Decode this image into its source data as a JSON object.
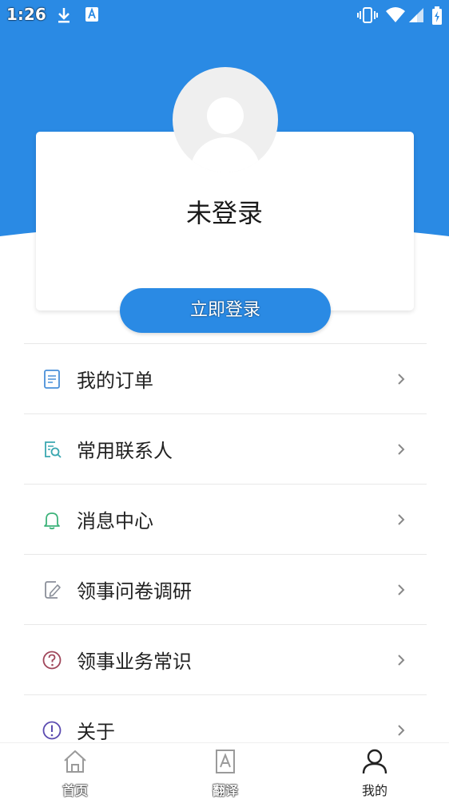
{
  "status_bar": {
    "time": "1:26"
  },
  "profile": {
    "status": "未登录",
    "login_button": "立即登录"
  },
  "menu": {
    "items": [
      {
        "label": "我的订单",
        "icon": "order-list-icon",
        "color": "#4a90d9"
      },
      {
        "label": "常用联系人",
        "icon": "contacts-search-icon",
        "color": "#3aa7b0"
      },
      {
        "label": "消息中心",
        "icon": "bell-icon",
        "color": "#3db37a"
      },
      {
        "label": "领事问卷调研",
        "icon": "survey-edit-icon",
        "color": "#8a8f99"
      },
      {
        "label": "领事业务常识",
        "icon": "question-circle-icon",
        "color": "#a0465a"
      },
      {
        "label": "关于",
        "icon": "info-circle-icon",
        "color": "#5b4bb0"
      }
    ]
  },
  "bottom_nav": {
    "items": [
      {
        "label": "首页",
        "icon": "home-icon"
      },
      {
        "label": "翻译",
        "icon": "translate-icon"
      },
      {
        "label": "我的",
        "icon": "profile-icon",
        "active": true
      }
    ]
  },
  "colors": {
    "primary": "#2a8ae4",
    "divider": "#e8e8e8"
  }
}
